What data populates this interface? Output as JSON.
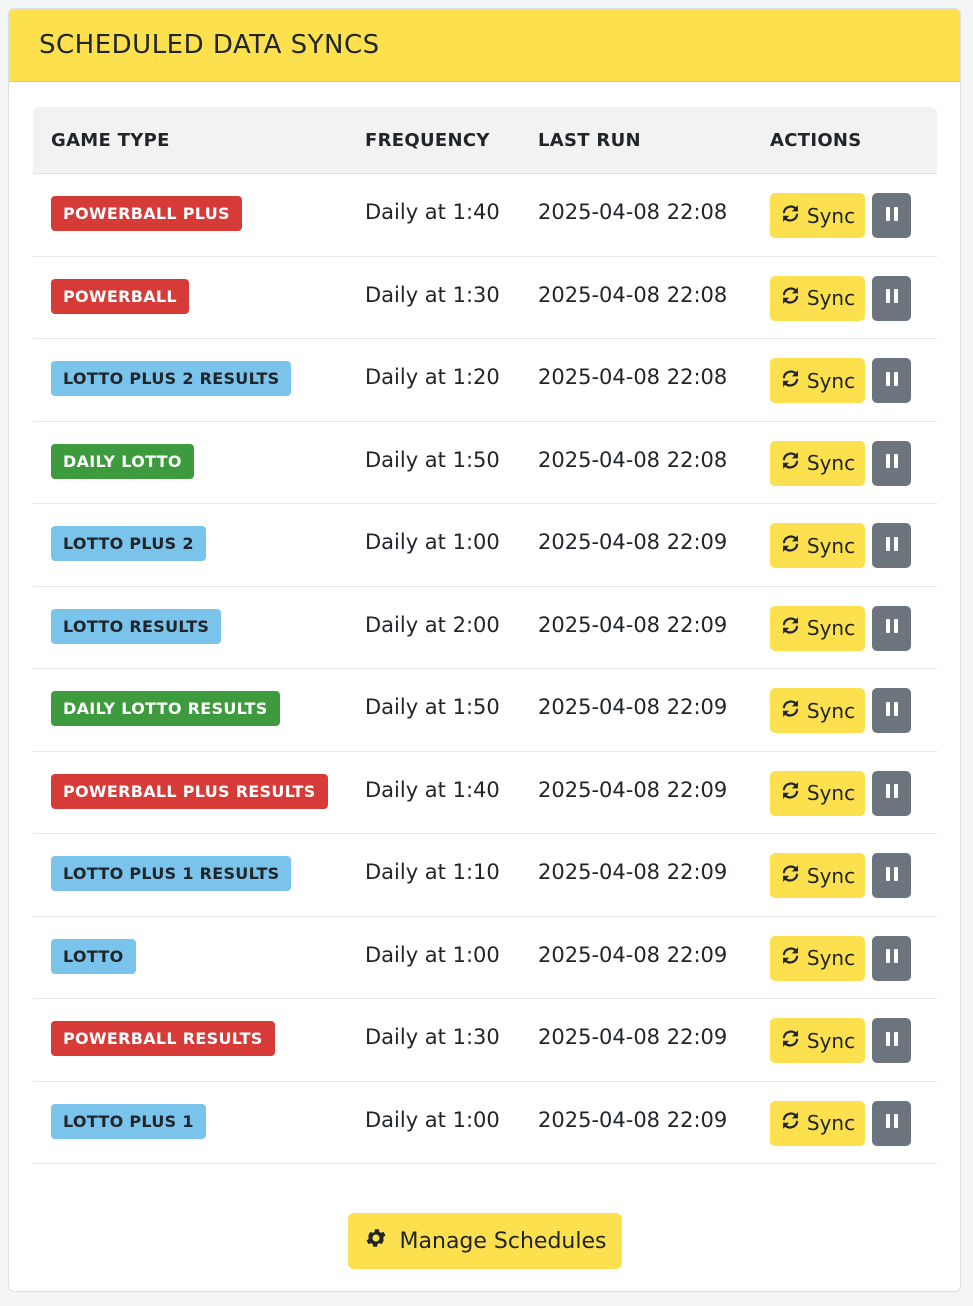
{
  "title": "SCHEDULED DATA SYNCS",
  "columns": {
    "game_type": "GAME TYPE",
    "frequency": "FREQUENCY",
    "last_run": "LAST RUN",
    "actions": "ACTIONS"
  },
  "sync_label": "Sync",
  "manage_label": "Manage Schedules",
  "colors": {
    "header_yellow": "#fce04e",
    "badge_red": "#d63b37",
    "badge_blue": "#7ac3ea",
    "badge_green": "#3d9b3d",
    "pause_gray": "#6c757d"
  },
  "rows": [
    {
      "game": "POWERBALL PLUS",
      "color": "red",
      "frequency": "Daily at 1:40",
      "last_run": "2025-04-08 22:08"
    },
    {
      "game": "POWERBALL",
      "color": "red",
      "frequency": "Daily at 1:30",
      "last_run": "2025-04-08 22:08"
    },
    {
      "game": "LOTTO PLUS 2 RESULTS",
      "color": "blue",
      "frequency": "Daily at 1:20",
      "last_run": "2025-04-08 22:08"
    },
    {
      "game": "DAILY LOTTO",
      "color": "green",
      "frequency": "Daily at 1:50",
      "last_run": "2025-04-08 22:08"
    },
    {
      "game": "LOTTO PLUS 2",
      "color": "blue",
      "frequency": "Daily at 1:00",
      "last_run": "2025-04-08 22:09"
    },
    {
      "game": "LOTTO RESULTS",
      "color": "blue",
      "frequency": "Daily at 2:00",
      "last_run": "2025-04-08 22:09"
    },
    {
      "game": "DAILY LOTTO RESULTS",
      "color": "green",
      "frequency": "Daily at 1:50",
      "last_run": "2025-04-08 22:09"
    },
    {
      "game": "POWERBALL PLUS RESULTS",
      "color": "red",
      "frequency": "Daily at 1:40",
      "last_run": "2025-04-08 22:09"
    },
    {
      "game": "LOTTO PLUS 1 RESULTS",
      "color": "blue",
      "frequency": "Daily at 1:10",
      "last_run": "2025-04-08 22:09"
    },
    {
      "game": "LOTTO",
      "color": "blue",
      "frequency": "Daily at 1:00",
      "last_run": "2025-04-08 22:09"
    },
    {
      "game": "POWERBALL RESULTS",
      "color": "red",
      "frequency": "Daily at 1:30",
      "last_run": "2025-04-08 22:09"
    },
    {
      "game": "LOTTO PLUS 1",
      "color": "blue",
      "frequency": "Daily at 1:00",
      "last_run": "2025-04-08 22:09"
    }
  ]
}
